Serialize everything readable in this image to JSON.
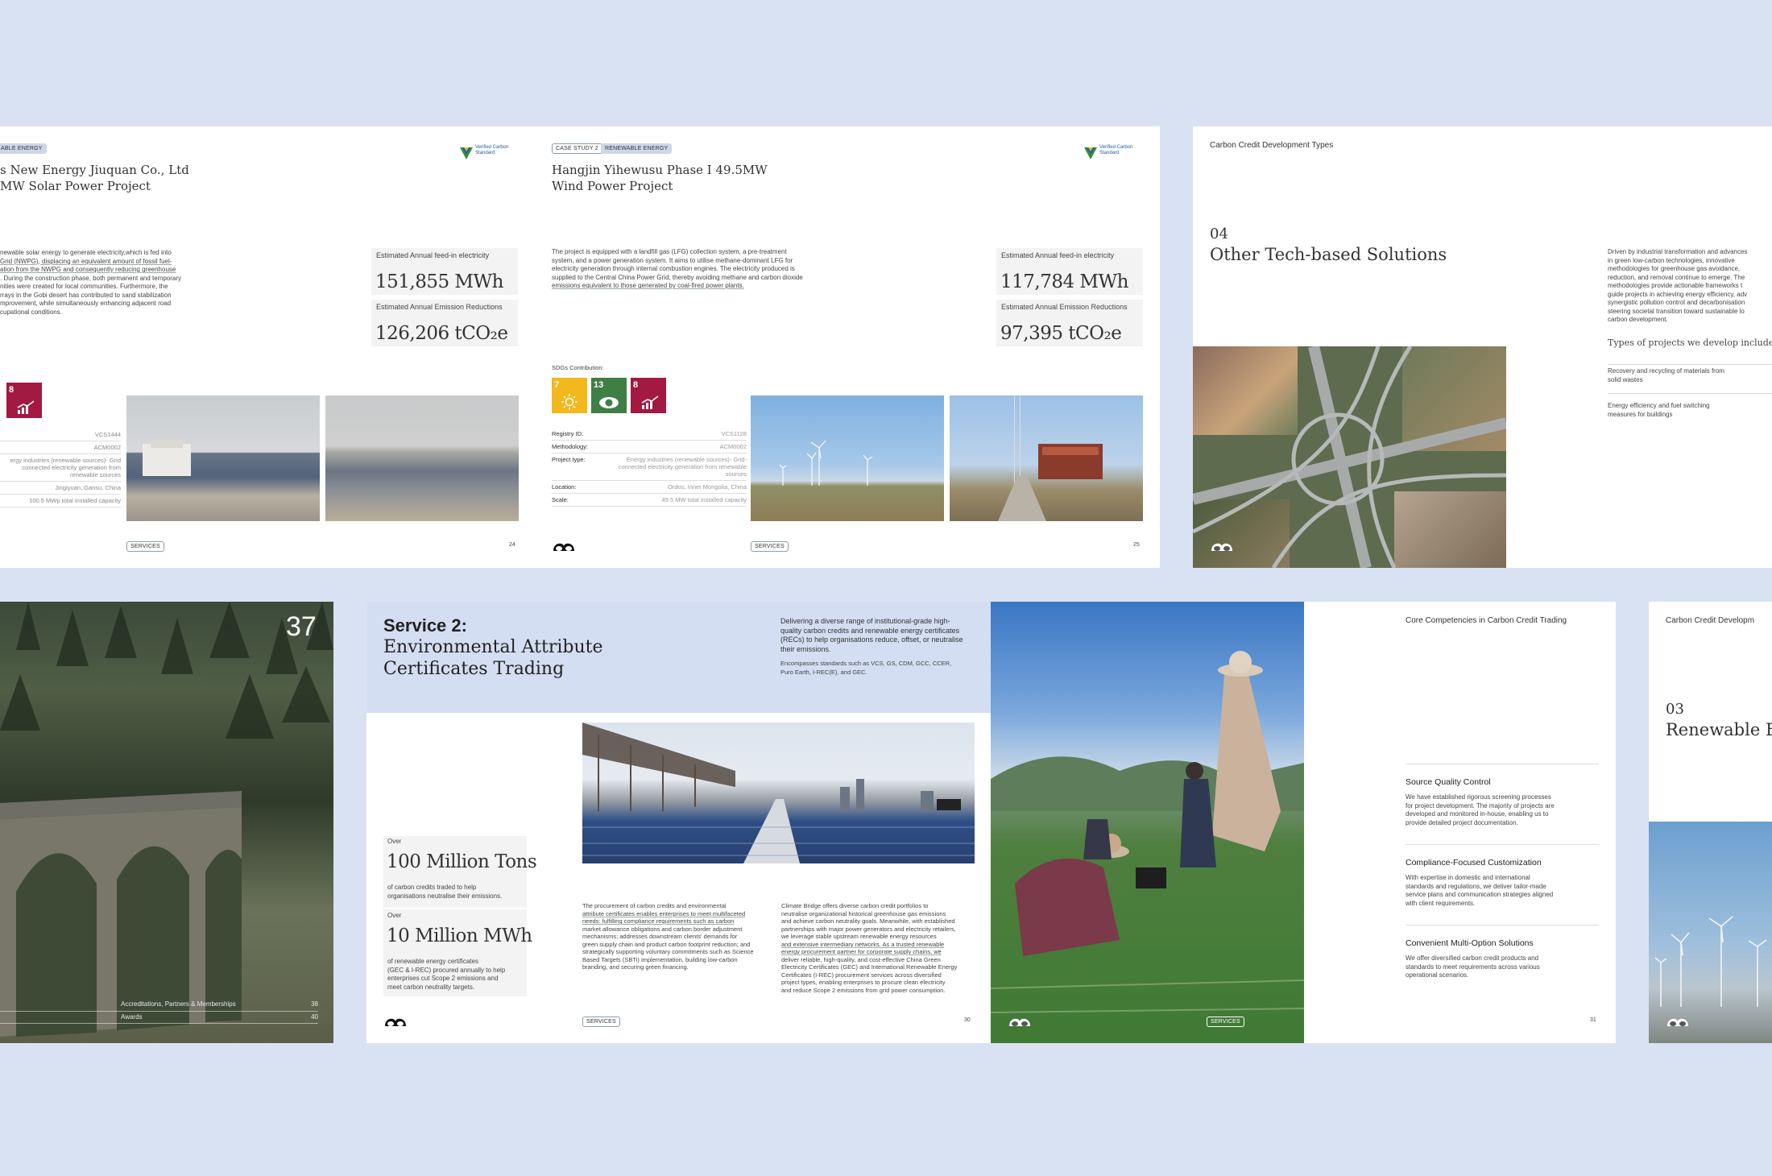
{
  "spread1": {
    "tag_energy": "ABLE ENERGY",
    "title_line1": "s New Energy Jiuquan Co., Ltd",
    "title_line2": "MW Solar Power Project",
    "body": [
      "newable solar energy to generate electricity,which is fed into",
      "Grid (NWPG), displacing an equivalent amount of fossil fuel-",
      "ation from the NWPG and consequently reducing greenhouse",
      ". During the construction phase, both permanent and temporary",
      "nities were created for local communities. Furthermore, the",
      "rrays in the Gobi desert has contributed to sand stabilization",
      "mprovement, while simultaneously enhancing adjacent road",
      "cupational conditions."
    ],
    "stat1_label": "Estimated Annual feed-in electricity",
    "stat1_value": "151,855 MWh",
    "stat2_label": "Estimated Annual Emission Reductions",
    "stat2_value": "126,206 tCO₂e",
    "registry": [
      "VCS1444",
      "ACM0002",
      "ergy industries (renewable sources)- Grid connected electricity generation from renewable sources",
      "Jingiyuan, Gansu, China",
      "100.5 MWp total installed capacity"
    ],
    "footer_tag": "SERVICES",
    "page_no": "24",
    "logo_text": "Verified Carbon Standard"
  },
  "spread2": {
    "tag_case": "CASE STUDY 2",
    "tag_energy": "RENEWABLE ENERGY",
    "title_line1": "Hangjin Yihewusu Phase I 49.5MW",
    "title_line2": "Wind Power Project",
    "body": [
      "The project is equipped with a landfill gas (LFG) collection system, a pre-treatment",
      "system, and a power generation system. It aims to utilise methane-dominant LFG for",
      "electricity generation through internal combustion engines. The electricity produced is",
      "supplied to the Central China Power Grid, thereby avoiding methane and carbon dioxide",
      "emissions equivalent to those generated by coal-fired power plants."
    ],
    "stat1_label": "Estimated Annual feed-in electricity",
    "stat1_value": "117,784 MWh",
    "stat2_label": "Estimated Annual Emission Reductions",
    "stat2_value": "97,395 tCO₂e",
    "sdg_label": "SDGs Contribution:",
    "sdgs": [
      {
        "num": "7",
        "text": "AFFORDABLE AND CLEAN ENERGY",
        "color": "#f2b81c"
      },
      {
        "num": "13",
        "text": "CLIMATE ACTION",
        "color": "#3f7e44"
      },
      {
        "num": "8",
        "text": "DECENT WORK AND ECONOMIC GROWTH",
        "color": "#a21942"
      }
    ],
    "registry": [
      {
        "k": "Registry ID:",
        "v": "VCS1128"
      },
      {
        "k": "Methodology:",
        "v": "ACM0002"
      },
      {
        "k": "Project type:",
        "v": "Energy industries (renewable sources)- Grid-connected electricity generation from renewable sources"
      },
      {
        "k": "Location:",
        "v": "Ordos, Inner Mongolia, China"
      },
      {
        "k": "Scale:",
        "v": "49.5 MW total installed capacity"
      }
    ],
    "footer_tag": "SERVICES",
    "page_no": "25",
    "logo_text": "Verified Carbon Standard"
  },
  "spread3": {
    "header": "Carbon Credit Development Types",
    "number": "04",
    "title": "Other Tech-based Solutions",
    "body": [
      "Driven by industrial transformation and advances",
      "in green low-carbon technologies, innovative",
      "methodologies for greenhouse gas avoidance,",
      "reduction, and removal continue to emerge. The",
      "methodologies provide actionable frameworks t",
      "guide projects in achieving energy efficiency, adv",
      "synergistic pollution control and decarbonisation",
      "steering societal transition toward sustainable lo",
      "carbon development."
    ],
    "types_label": "Types of projects we develop include:",
    "types": [
      "Recovery and recycling of materials from solid wastes",
      "Energy efficiency and fuel switching measures for buildings"
    ]
  },
  "spread4": {
    "page_number": "37",
    "toc": [
      {
        "label": "Accreditations, Partners & Memberships",
        "page": "38"
      },
      {
        "label": "Awards",
        "page": "40"
      }
    ]
  },
  "spread5": {
    "title_line1": "Service 2:",
    "title_line2": "Environmental Attribute",
    "title_line3": "Certificates Trading",
    "intro": [
      "Delivering a diverse range of institutional-grade high-",
      "quality carbon credits and renewable energy certificates",
      "(RECs) to help organisations reduce, offset, or neutralise",
      "their emissions."
    ],
    "standards": [
      "Encompasses standards such as VCS, GS, CDM, GCC, CCER,",
      "Puro Earth, I-REC(E), and GEC."
    ],
    "stat1_over": "Over",
    "stat1_value": "100 Million Tons",
    "stat1_desc": [
      "of carbon credits traded to help",
      "organisations neutralise their emissions."
    ],
    "stat2_over": "Over",
    "stat2_value": "10 Million MWh",
    "stat2_desc": [
      "of renewable energy certificates",
      "(GEC & I-REC) procured annually to help",
      "enterprises cut Scope 2 emissions and",
      "meet carbon neutrality targets."
    ],
    "col1": [
      "The procurement of carbon credits and environmental",
      "attribute certificates enables enterprises to meet multifaceted",
      "needs: fulfilling compliance requirements such as carbon",
      "market allowance obligations and carbon border adjustment",
      "mechanisms; addresses downstream clients' demands for",
      "green supply chain and product carbon footprint reduction; and",
      "strategically supporting voluntary commitments such as Science",
      "Based Targets (SBTi) implementation, building low-carbon",
      "branding, and securing green financing."
    ],
    "col2": [
      "Climate Bridge offers diverse carbon credit portfolios to",
      "neutralise organizational historical greenhouse gas emissions",
      "and achieve carbon neutrality goals. Meanwhile, with established",
      "partnerships with major power generators and electricity retailers,",
      "we leverage stable upstream renewable energy resources",
      "and extensive intermediary networks. As a trusted renewable",
      "energy procurement partner for corporate supply chains, we",
      "deliver reliable, high-quality, and cost-effective China Green",
      "Electricity Certificates (GEC) and International Renewable Energy",
      "Certificates (I-REC) procurement services across diversified",
      "project types, enabling enterprises to procure clean electricity",
      "and reduce Scope 2 emissions from grid power consumption."
    ],
    "footer_tag": "SERVICES",
    "page_no": "30"
  },
  "spread6": {
    "header": "Core Competencies in Carbon Credit Trading",
    "items": [
      {
        "title": "Source Quality Control",
        "desc": [
          "We have established rigorous screening processes",
          "for project development. The majority of projects are",
          "developed and monitored in-house, enabling us to",
          "provide detailed project documentation."
        ]
      },
      {
        "title": "Compliance-Focused Customization",
        "desc": [
          "With expertise in domestic and international",
          "standards and regulations, we deliver tailor-made",
          "service plans and communication strategies aligned",
          "with client requirements."
        ]
      },
      {
        "title": "Convenient Multi-Option Solutions",
        "desc": [
          "We offer diversified carbon credit products and",
          "standards to meet requirements across various",
          "operational scenarios."
        ]
      }
    ],
    "footer_tag": "SERVICES",
    "page_no": "31"
  },
  "spread7": {
    "header": "Carbon Credit Developm",
    "number": "03",
    "title": "Renewable E"
  }
}
